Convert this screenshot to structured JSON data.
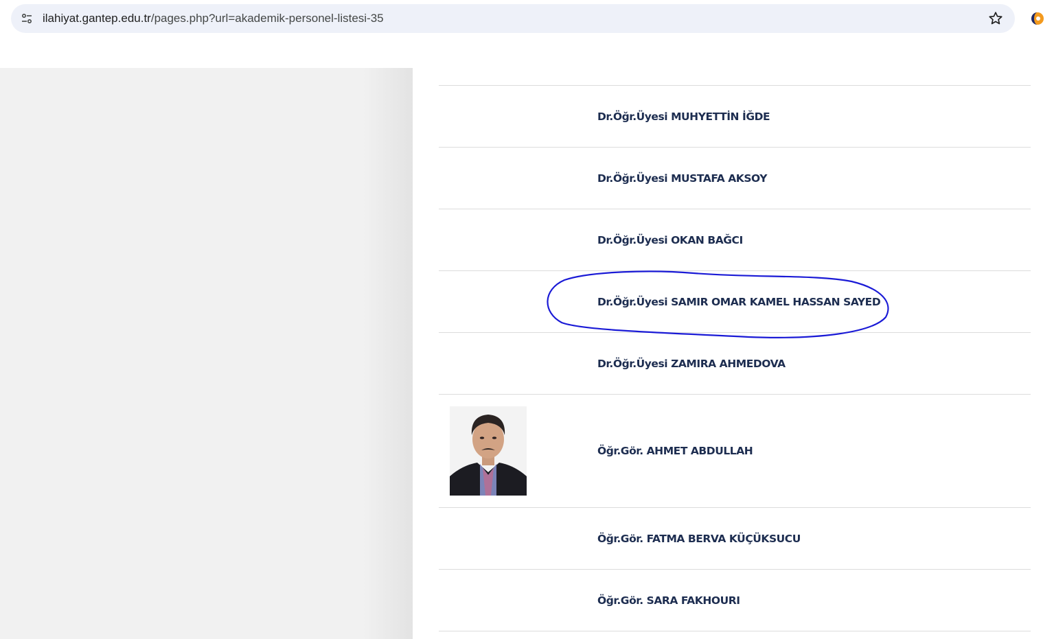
{
  "browser": {
    "url_host": "ilahiyat.gantep.edu.tr",
    "url_path": "/pages.php?url=akademik-personel-listesi-35",
    "icons": {
      "site_info": "tune-icon",
      "bookmark": "star-icon",
      "extension": "extension-icon"
    }
  },
  "staff": [
    {
      "name": "Dr.Öğr.Üyesi MUHYETTİN İĞDE",
      "has_photo": false
    },
    {
      "name": "Dr.Öğr.Üyesi MUSTAFA AKSOY",
      "has_photo": false
    },
    {
      "name": "Dr.Öğr.Üyesi OKAN BAĞCI",
      "has_photo": false
    },
    {
      "name": "Dr.Öğr.Üyesi SAMIR OMAR KAMEL HASSAN SAYED",
      "has_photo": false,
      "circled": true
    },
    {
      "name": "Dr.Öğr.Üyesi ZAMIRA AHMEDOVA",
      "has_photo": false
    },
    {
      "name": "Öğr.Gör. AHMET ABDULLAH",
      "has_photo": true
    },
    {
      "name": "Öğr.Gör. FATMA BERVA KÜÇÜKSUCU",
      "has_photo": false
    },
    {
      "name": "Öğr.Gör. SARA FAKHOURI",
      "has_photo": false
    }
  ],
  "colors": {
    "name_text": "#1d2d50",
    "annotation": "#1a1ad6",
    "omnibox": "#eef1f9"
  }
}
